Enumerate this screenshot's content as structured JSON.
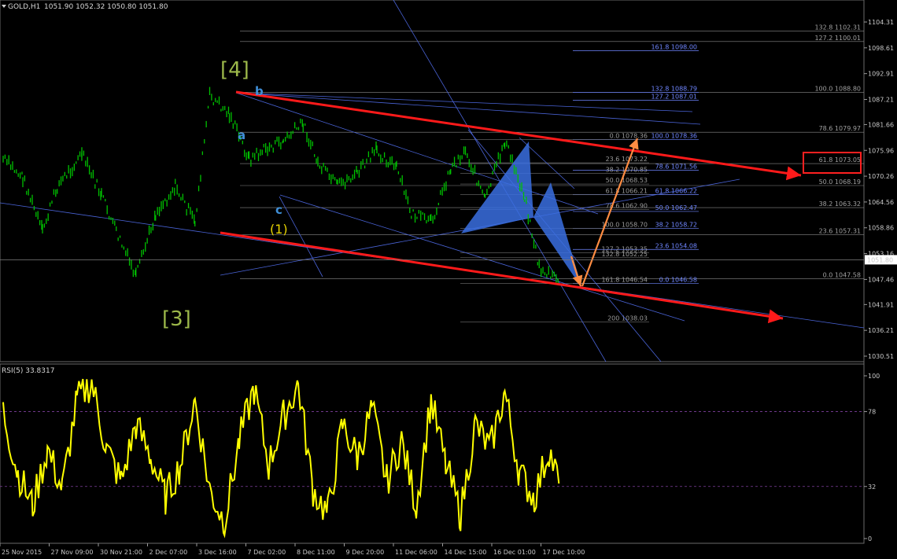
{
  "header": {
    "symbol": "GOLD,H1",
    "ohlc": "1051.90 1052.32 1050.80 1051.80",
    "rsi_label": "RSI(5) 33.8317"
  },
  "colors": {
    "background": "#000000",
    "candle": "#00c000",
    "rsi_line": "#ffff00",
    "trendline_red": "#ff1a1a",
    "thin_blue": "#4a64d8",
    "bat_fill": "#3a6fe0",
    "projection_orange": "#ff8c42",
    "fib_gray": "#8a8a8a",
    "fib_blue": "#6f86ff",
    "wave_green": "#9cb84a",
    "wave_blue": "#3f8fd8",
    "wave_yellow": "#e8d400"
  },
  "price_axis": {
    "ticks": [
      "1104.31",
      "1098.61",
      "1092.91",
      "1087.21",
      "1081.66",
      "1075.96",
      "1070.26",
      "1064.56",
      "1058.86",
      "1053.16",
      "1047.46",
      "1041.91",
      "1036.21",
      "1030.51"
    ],
    "current_price": "1051.80"
  },
  "rsi_axis": {
    "ticks": [
      "100",
      "78",
      "32",
      "0"
    ]
  },
  "time_axis": {
    "ticks": [
      "25 Nov 2015",
      "27 Nov 09:00",
      "30 Nov 21:00",
      "2 Dec 07:00",
      "3 Dec 16:00",
      "7 Dec 02:00",
      "8 Dec 11:00",
      "9 Dec 20:00",
      "11 Dec 06:00",
      "14 Dec 15:00",
      "16 Dec 01:00",
      "17 Dec 10:00"
    ]
  },
  "wave_labels": {
    "w4": "[4]",
    "w3": "[3]",
    "a": "a",
    "b": "b",
    "c": "c",
    "w1": "(1)"
  },
  "fib_levels_right": [
    {
      "text": "132.8 1102.31",
      "price": 1102.31
    },
    {
      "text": "127.2 1100.01",
      "price": 1100.01
    },
    {
      "text": "100.0 1088.80",
      "price": 1088.8
    },
    {
      "text": "78.6 1079.97",
      "price": 1079.97
    },
    {
      "text": "61.8 1073.05",
      "price": 1073.05
    },
    {
      "text": "50.0 1068.19",
      "price": 1068.19
    },
    {
      "text": "38.2 1063.32",
      "price": 1063.32
    },
    {
      "text": "23.6 1057.31",
      "price": 1057.31
    },
    {
      "text": "0.0 1047.58",
      "price": 1047.58
    }
  ],
  "fib_levels_mid": [
    {
      "text": "161.8 1098.00",
      "price": 1098.0
    },
    {
      "text": "132.8 1088.79",
      "price": 1088.79
    },
    {
      "text": "127.2 1087.01",
      "price": 1087.01
    },
    {
      "text": "100.0 1078.36",
      "price": 1078.36
    },
    {
      "text": "78.6 1071.56",
      "price": 1071.56
    },
    {
      "text": "61.8 1066.22",
      "price": 1066.22
    },
    {
      "text": "50.0 1062.47",
      "price": 1062.47
    },
    {
      "text": "38.2 1058.72",
      "price": 1058.72
    },
    {
      "text": "23.6 1054.08",
      "price": 1054.08
    },
    {
      "text": "0.0 1046.58",
      "price": 1046.58
    }
  ],
  "fib_levels_inner": [
    {
      "text": "0.0 1078.36",
      "price": 1078.36
    },
    {
      "text": "23.6 1073.22",
      "price": 1073.22
    },
    {
      "text": "38.2 1070.85",
      "price": 1070.85
    },
    {
      "text": "50.0 1068.53",
      "price": 1068.53
    },
    {
      "text": "61.8 1066.21",
      "price": 1066.21
    },
    {
      "text": "78.6 1062.90",
      "price": 1062.9
    },
    {
      "text": "100.0 1058.70",
      "price": 1058.7
    },
    {
      "text": "127.2 1053.35",
      "price": 1053.35
    },
    {
      "text": "132.8 1052.25",
      "price": 1052.25
    },
    {
      "text": "161.8 1046.54",
      "price": 1046.54
    },
    {
      "text": "200 1038.03",
      "price": 1038.03
    }
  ],
  "chart_data": {
    "type": "line",
    "title": "GOLD,H1",
    "price_ylim": [
      1030.51,
      1104.31
    ],
    "rsi_ylim": [
      0,
      100
    ],
    "rsi_levels": [
      78,
      32
    ],
    "x_categories": [
      "25 Nov 2015",
      "27 Nov 09:00",
      "30 Nov 21:00",
      "2 Dec 07:00",
      "3 Dec 16:00",
      "7 Dec 02:00",
      "8 Dec 11:00",
      "9 Dec 20:00",
      "11 Dec 06:00",
      "14 Dec 15:00",
      "16 Dec 01:00",
      "17 Dec 10:00"
    ],
    "price_series": {
      "name": "GOLD,H1",
      "x_index": [
        0,
        0.4,
        0.8,
        1.1,
        1.6,
        2.0,
        2.3,
        2.7,
        3.1,
        3.5,
        3.9,
        4.2,
        4.6,
        5.0,
        5.3,
        5.7,
        6.1,
        6.4,
        6.8,
        7.2,
        7.6,
        8.0,
        8.3,
        8.7,
        9.1,
        9.4,
        9.8,
        10.2,
        10.6,
        10.9,
        11.3
      ],
      "values": [
        1074,
        1070,
        1058,
        1068,
        1075,
        1066,
        1058,
        1048,
        1062,
        1068,
        1060,
        1088,
        1084,
        1074,
        1076,
        1078,
        1082,
        1073,
        1068,
        1071,
        1076,
        1072,
        1062,
        1060,
        1072,
        1076,
        1065,
        1078,
        1066,
        1050,
        1047
      ]
    },
    "rsi_series": {
      "name": "RSI(5)",
      "x_index": [
        0,
        0.3,
        0.6,
        0.9,
        1.2,
        1.5,
        1.8,
        2.1,
        2.4,
        2.7,
        3.0,
        3.3,
        3.6,
        3.9,
        4.2,
        4.5,
        4.8,
        5.1,
        5.4,
        5.7,
        6.0,
        6.3,
        6.6,
        6.9,
        7.2,
        7.5,
        7.8,
        8.1,
        8.4,
        8.7,
        9.0,
        9.3,
        9.6,
        9.9,
        10.2,
        10.5,
        10.8,
        11.1,
        11.3
      ],
      "values": [
        78,
        40,
        20,
        55,
        30,
        85,
        96,
        55,
        35,
        70,
        50,
        25,
        45,
        85,
        30,
        10,
        60,
        92,
        45,
        75,
        95,
        30,
        15,
        70,
        50,
        80,
        35,
        60,
        20,
        85,
        45,
        15,
        70,
        55,
        90,
        40,
        25,
        55,
        33.8
      ]
    }
  }
}
